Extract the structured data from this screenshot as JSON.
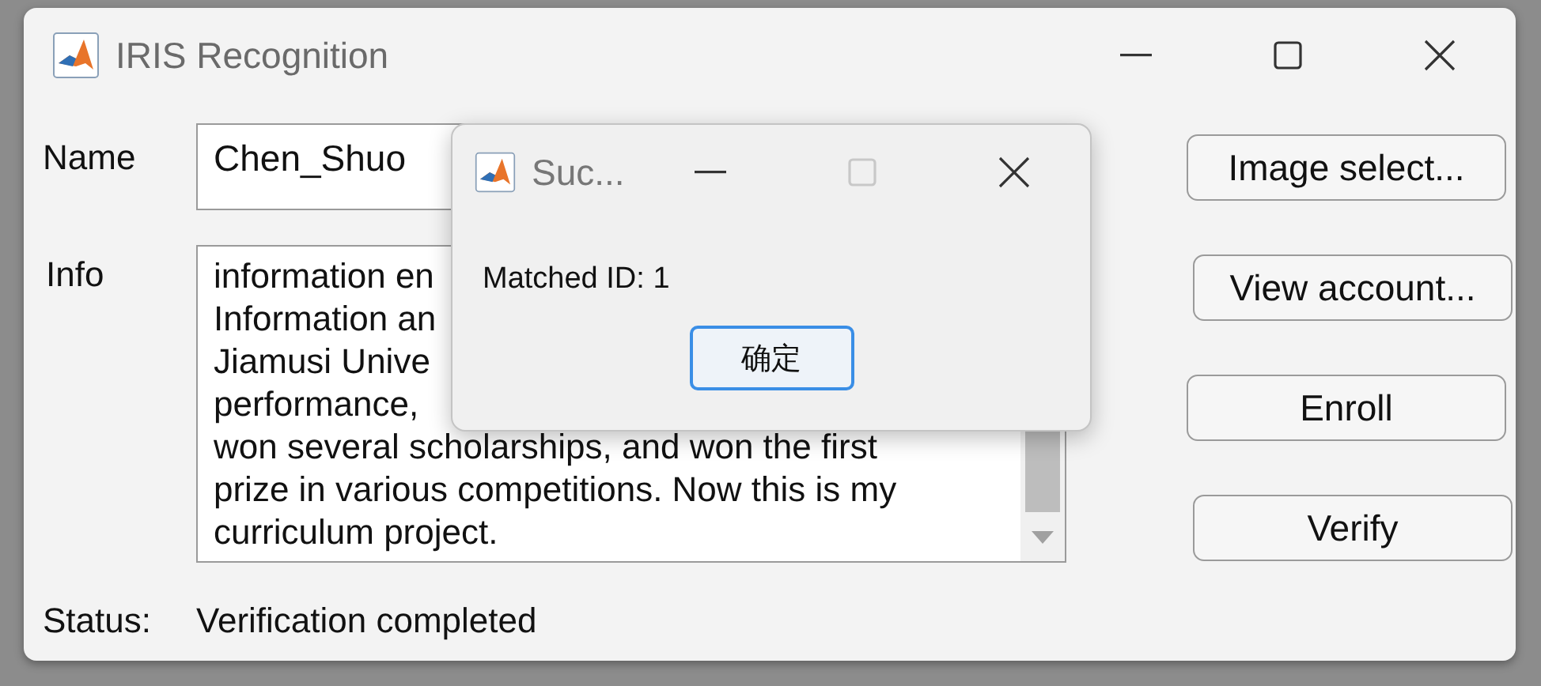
{
  "window": {
    "title": "IRIS Recognition"
  },
  "form": {
    "name_label": "Name",
    "name_value": "Chen_Shuo",
    "info_label": "Info",
    "info_lines": [
      "information en",
      "Information an",
      "Jiamusi Unive",
      "performance,",
      "won several scholarships, and won the first",
      "prize in various competitions. Now this is my",
      "curriculum project."
    ],
    "status_label": "Status:",
    "status_value": "Verification completed"
  },
  "buttons": [
    {
      "label": "Image select..."
    },
    {
      "label": "View account..."
    },
    {
      "label": "Enroll"
    },
    {
      "label": "Verify"
    }
  ],
  "dialog": {
    "title": "Suc...",
    "message": "Matched ID: 1",
    "button": "确定",
    "maximize_disabled": true
  }
}
